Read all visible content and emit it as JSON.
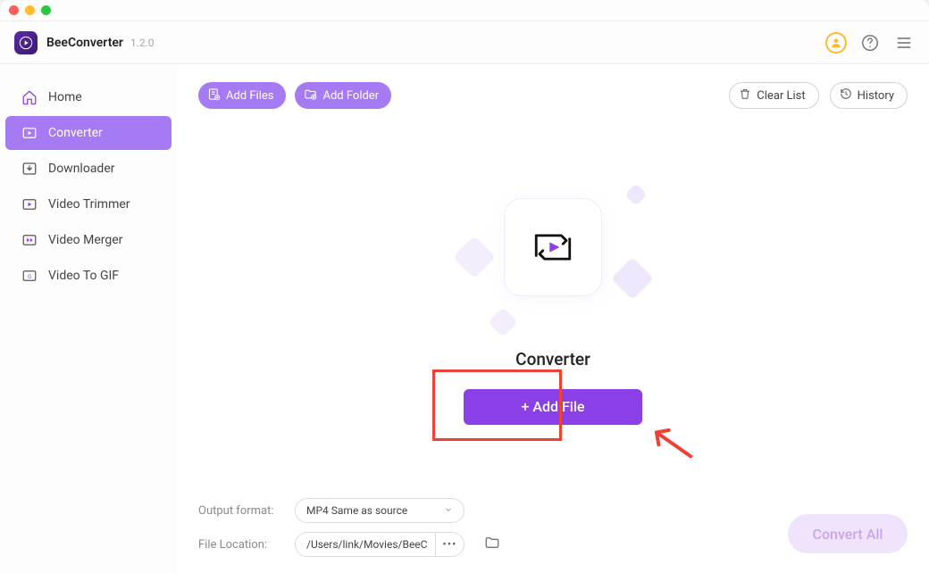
{
  "app": {
    "title": "BeeConverter",
    "version": "1.2.0"
  },
  "sidebar": {
    "items": [
      {
        "label": "Home",
        "icon": "home"
      },
      {
        "label": "Converter",
        "icon": "converter",
        "active": true
      },
      {
        "label": "Downloader",
        "icon": "download"
      },
      {
        "label": "Video Trimmer",
        "icon": "trimmer"
      },
      {
        "label": "Video Merger",
        "icon": "merger"
      },
      {
        "label": "Video To GIF",
        "icon": "gif"
      }
    ]
  },
  "toolbar": {
    "add_files": "Add Files",
    "add_folder": "Add Folder",
    "clear_list": "Clear List",
    "history": "History"
  },
  "dropzone": {
    "title": "Converter",
    "add_file_label": "+ Add File"
  },
  "footer": {
    "output_format_label": "Output format:",
    "output_format_value": "MP4 Same as source",
    "file_location_label": "File Location:",
    "file_location_value": "/Users/link/Movies/BeeC",
    "convert_all": "Convert All"
  },
  "colors": {
    "accent": "#a67af2",
    "primary_btn": "#8b3fe6",
    "annotation": "#ef4136",
    "avatar_ring": "#fdbb2d"
  }
}
